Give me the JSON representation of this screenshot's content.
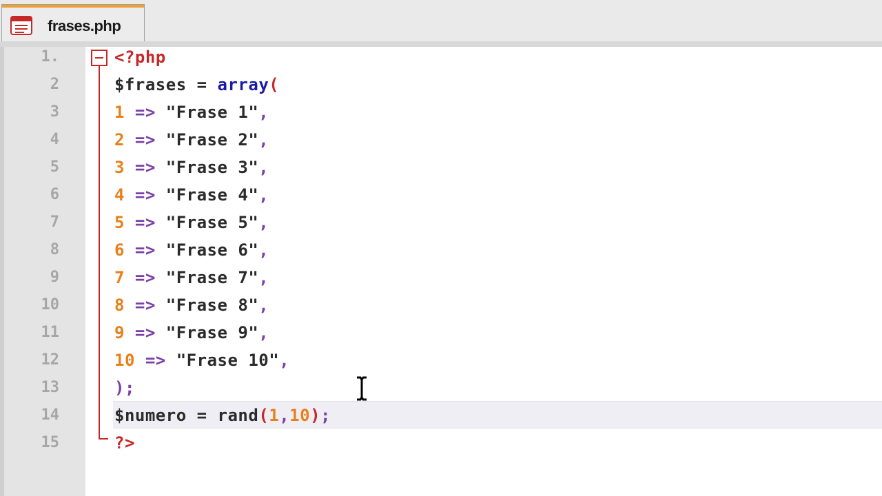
{
  "tab": {
    "filename": "frases.php",
    "icon": "php-file-icon"
  },
  "line_numbers": [
    "1.",
    "2",
    "3",
    "4",
    "5",
    "6",
    "7",
    "8",
    "9",
    "10",
    "11",
    "12",
    "13",
    "14",
    "15"
  ],
  "code": {
    "line1": "<?php",
    "line2_var": "$frases",
    "line2_op": " = ",
    "line2_fn": "array",
    "line2_paren": "(",
    "items": [
      {
        "key": "1",
        "arrow": " => ",
        "str": "\"Frase 1\"",
        "comma": ","
      },
      {
        "key": "2",
        "arrow": " => ",
        "str": "\"Frase 2\"",
        "comma": ","
      },
      {
        "key": "3",
        "arrow": " => ",
        "str": "\"Frase 3\"",
        "comma": ","
      },
      {
        "key": "4",
        "arrow": " => ",
        "str": "\"Frase 4\"",
        "comma": ","
      },
      {
        "key": "5",
        "arrow": " => ",
        "str": "\"Frase 5\"",
        "comma": ","
      },
      {
        "key": "6",
        "arrow": " => ",
        "str": "\"Frase 6\"",
        "comma": ","
      },
      {
        "key": "7",
        "arrow": " => ",
        "str": "\"Frase 7\"",
        "comma": ","
      },
      {
        "key": "8",
        "arrow": " => ",
        "str": "\"Frase 8\"",
        "comma": ","
      },
      {
        "key": "9",
        "arrow": " => ",
        "str": "\"Frase 9\"",
        "comma": ","
      },
      {
        "key": "10",
        "arrow": " => ",
        "str": "\"Frase 10\"",
        "comma": ","
      }
    ],
    "line13": ");",
    "line14_var": "$numero",
    "line14_op": " = ",
    "line14_fn": "rand",
    "line14_open": "(",
    "line14_a": "1",
    "line14_comma": ",",
    "line14_b": "10",
    "line14_close": ")",
    "line14_semi": ";",
    "line15": "?>"
  },
  "colors": {
    "php_tag": "#c62828",
    "function": "#1a1aa6",
    "number": "#e8801a",
    "punctuation": "#7b3fa8",
    "current_line": "#eeeef4"
  }
}
